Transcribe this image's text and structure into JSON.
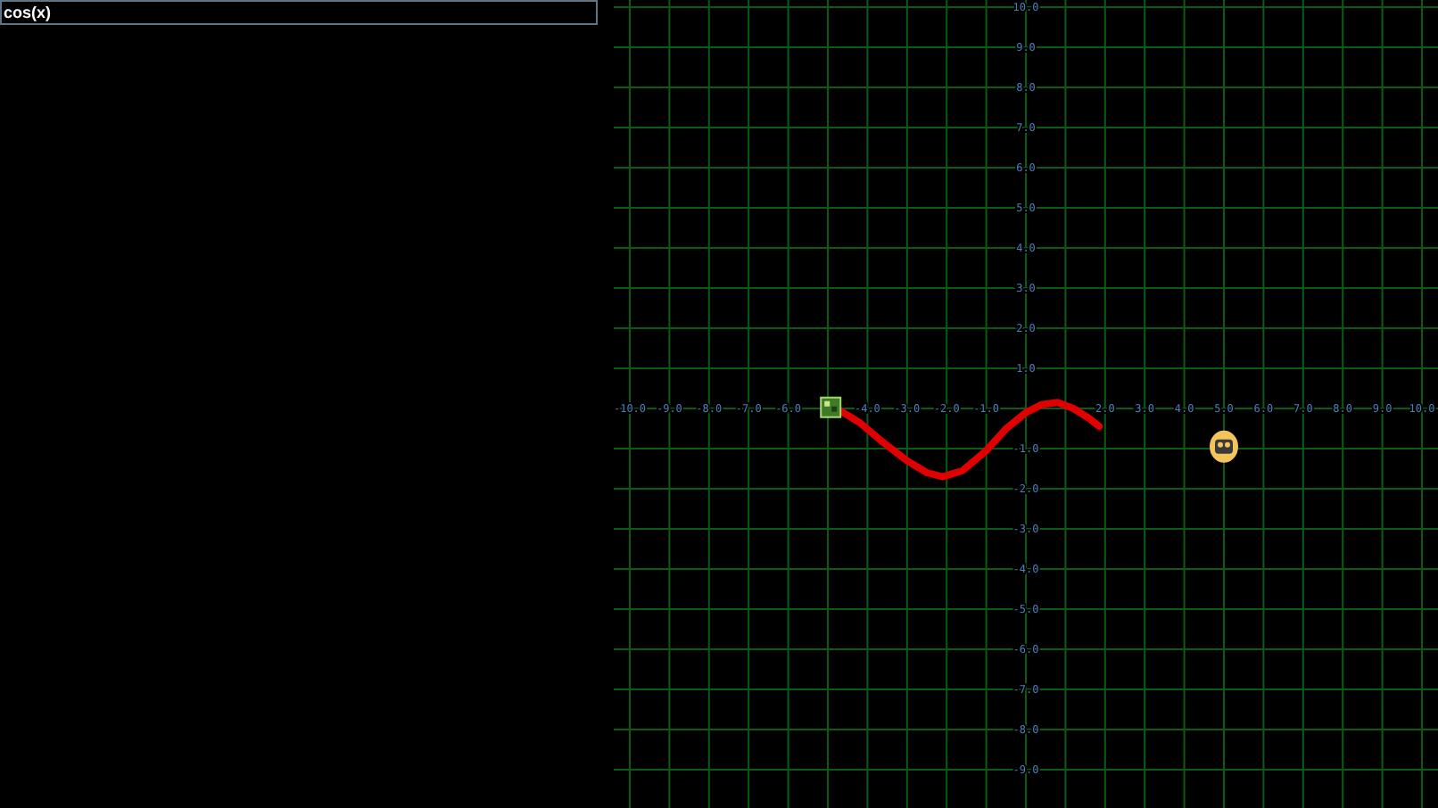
{
  "expression_field": {
    "value": "cos(x)"
  },
  "graph": {
    "chart_data": {
      "type": "line",
      "xlim": [
        -10,
        10
      ],
      "ylim": [
        -10,
        10
      ],
      "xticks": [
        {
          "value": -10,
          "label": "-10.0"
        },
        {
          "value": -9,
          "label": "-9.0"
        },
        {
          "value": -8,
          "label": "-8.0"
        },
        {
          "value": -7,
          "label": "-7.0"
        },
        {
          "value": -6,
          "label": "-6.0"
        },
        {
          "value": -4,
          "label": "-4.0"
        },
        {
          "value": -3,
          "label": "-3.0"
        },
        {
          "value": -2,
          "label": "-2.0"
        },
        {
          "value": -1,
          "label": "-1.0"
        },
        {
          "value": 2,
          "label": "2.0"
        },
        {
          "value": 3,
          "label": "3.0"
        },
        {
          "value": 4,
          "label": "4.0"
        },
        {
          "value": 5,
          "label": "5.0"
        },
        {
          "value": 6,
          "label": "6.0"
        },
        {
          "value": 7,
          "label": "7.0"
        },
        {
          "value": 8,
          "label": "8.0"
        },
        {
          "value": 9,
          "label": "9.0"
        },
        {
          "value": 10,
          "label": "10.0"
        }
      ],
      "yticks": [
        {
          "value": 10,
          "label": "10.0"
        },
        {
          "value": 9,
          "label": "9.0"
        },
        {
          "value": 8,
          "label": "8.0"
        },
        {
          "value": 7,
          "label": "7.0"
        },
        {
          "value": 6,
          "label": "6.0"
        },
        {
          "value": 5,
          "label": "5.0"
        },
        {
          "value": 4,
          "label": "4.0"
        },
        {
          "value": 3,
          "label": "3.0"
        },
        {
          "value": 2,
          "label": "2.0"
        },
        {
          "value": 1,
          "label": "1.0"
        },
        {
          "value": -1,
          "label": "-1.0"
        },
        {
          "value": -2,
          "label": "-2.0"
        },
        {
          "value": -3,
          "label": "-3.0"
        },
        {
          "value": -4,
          "label": "-4.0"
        },
        {
          "value": -5,
          "label": "-5.0"
        },
        {
          "value": -6,
          "label": "-6.0"
        },
        {
          "value": -7,
          "label": "-7.0"
        },
        {
          "value": -8,
          "label": "-8.0"
        },
        {
          "value": -9,
          "label": "-9.0"
        }
      ],
      "x": [
        -4.7,
        -4.2,
        -3.6,
        -3,
        -2.5,
        -2.1,
        -1.6,
        -1,
        -0.5,
        0,
        0.4,
        0.8,
        1.2,
        1.6,
        1.85
      ],
      "grid": true,
      "series": [
        {
          "color": "#e00000",
          "values": [
            -0.05,
            -0.35,
            -0.85,
            -1.3,
            -1.6,
            -1.7,
            -1.55,
            -1.05,
            -0.5,
            -0.1,
            0.1,
            0.15,
            0.0,
            -0.25,
            -0.45
          ]
        }
      ]
    }
  }
}
